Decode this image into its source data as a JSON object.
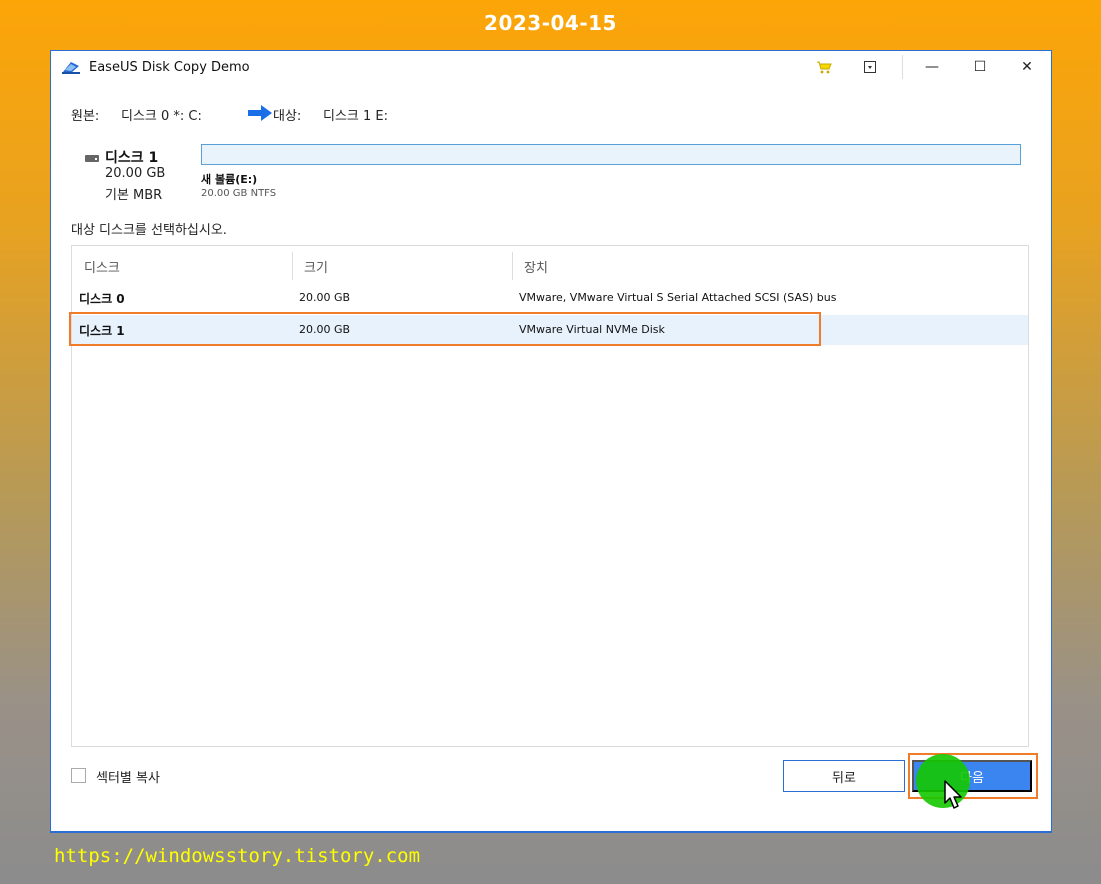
{
  "date": "2023-04-15",
  "url": "https://windowsstory.tistory.com",
  "window": {
    "title": "EaseUS Disk Copy Demo",
    "controls": {
      "minimize": "—",
      "maximize": "☐",
      "close": "✕"
    }
  },
  "source_target": {
    "source_label": "원본:",
    "source_value": "디스크 0 *: C:",
    "target_label": "대상:",
    "target_value": "디스크 1 E:"
  },
  "disk_card": {
    "name": "디스크 1",
    "size": "20.00 GB",
    "type": "기본 MBR",
    "volume_name": "새 볼륨(E:)",
    "volume_info": "20.00 GB NTFS"
  },
  "select_label": "대상 디스크를 선택하십시오.",
  "table": {
    "columns": [
      "디스크",
      "크기",
      "장치"
    ],
    "rows": [
      {
        "disk": "디스크 0",
        "size": "20.00 GB",
        "device": "VMware,  VMware Virtual S Serial Attached SCSI (SAS) bus"
      },
      {
        "disk": "디스크 1",
        "size": "20.00 GB",
        "device": "VMware Virtual NVMe Disk"
      }
    ]
  },
  "sector_copy_label": "섹터별 복사",
  "buttons": {
    "back": "뒤로",
    "next": "다음"
  },
  "colors": {
    "accent": "#3b85f0",
    "highlight": "#f07b28",
    "arrow": "#1a6fe8"
  }
}
